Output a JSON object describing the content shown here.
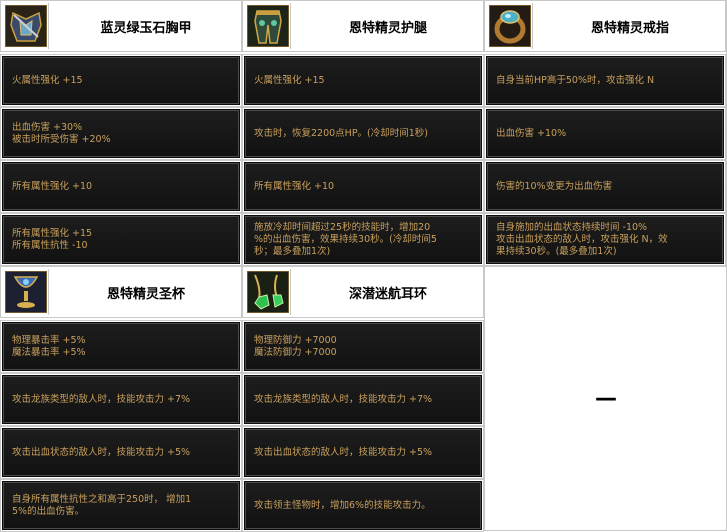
{
  "items": [
    {
      "name": "蓝灵绿玉石胸甲",
      "icon": "chest-armor-icon",
      "effects": [
        "火属性强化 +15",
        "出血伤害 +30%\n被击时所受伤害 +20%",
        "所有属性强化 +10",
        "所有属性强化 +15\n所有属性抗性 -10"
      ]
    },
    {
      "name": "恩特精灵护腿",
      "icon": "leg-armor-icon",
      "effects": [
        "火属性强化 +15",
        "攻击时，恢复2200点HP。(冷却时间1秒)",
        "所有属性强化 +10",
        "施放冷却时间超过25秒的技能时，增加20\n%的出血伤害，效果持续30秒。(冷却时间5\n秒；最多叠加1次)"
      ]
    },
    {
      "name": "恩特精灵戒指",
      "icon": "ring-icon",
      "effects": [
        "自身当前HP高于50%时，攻击强化 N",
        "出血伤害 +10%",
        "伤害的10%变更为出血伤害",
        "自身施加的出血状态持续时间 -10%\n攻击出血状态的敌人时，攻击强化 N，效\n果持续30秒。(最多叠加1次)"
      ]
    },
    {
      "name": "恩特精灵圣杯",
      "icon": "chalice-icon",
      "effects": [
        "物理暴击率 +5%\n魔法暴击率 +5%",
        "攻击龙族类型的敌人时，技能攻击力 +7%",
        "攻击出血状态的敌人时，技能攻击力 +5%",
        "自身所有属性抗性之和高于250时， 增加1\n5%的出血伤害。"
      ]
    },
    {
      "name": "深潜迷航耳环",
      "icon": "earring-icon",
      "effects": [
        "物理防御力 +7000\n魔法防御力 +7000",
        "攻击龙族类型的敌人时，技能攻击力 +7%",
        "攻击出血状态的敌人时，技能攻击力 +5%",
        "攻击领主怪物时，增加6%的技能攻击力。"
      ]
    }
  ],
  "empty_slot": {
    "text": "—"
  }
}
